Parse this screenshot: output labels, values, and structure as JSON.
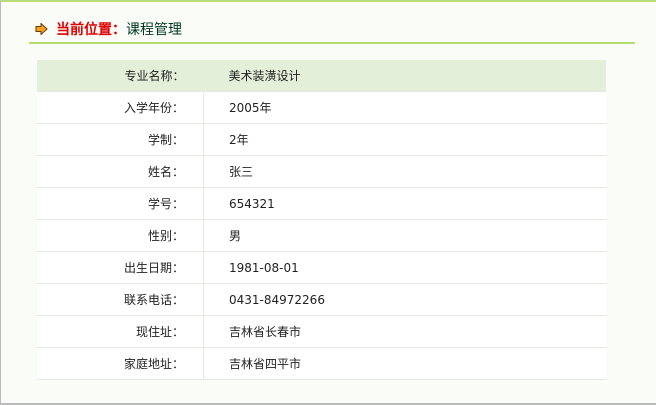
{
  "breadcrumb": {
    "label": "当前位置：",
    "value": "课程管理"
  },
  "rows": [
    {
      "label": "专业名称：",
      "value": "美术装潢设计"
    },
    {
      "label": "入学年份：",
      "value": "2005年"
    },
    {
      "label": "学制：",
      "value": "2年"
    },
    {
      "label": "姓名：",
      "value": "张三"
    },
    {
      "label": "学号：",
      "value": "654321"
    },
    {
      "label": "性别：",
      "value": "男"
    },
    {
      "label": "出生日期：",
      "value": "1981-08-01"
    },
    {
      "label": "联系电话：",
      "value": "0431-84972266"
    },
    {
      "label": "现住址：",
      "value": "吉林省长春市"
    },
    {
      "label": "家庭地址：",
      "value": "吉林省四平市"
    }
  ]
}
